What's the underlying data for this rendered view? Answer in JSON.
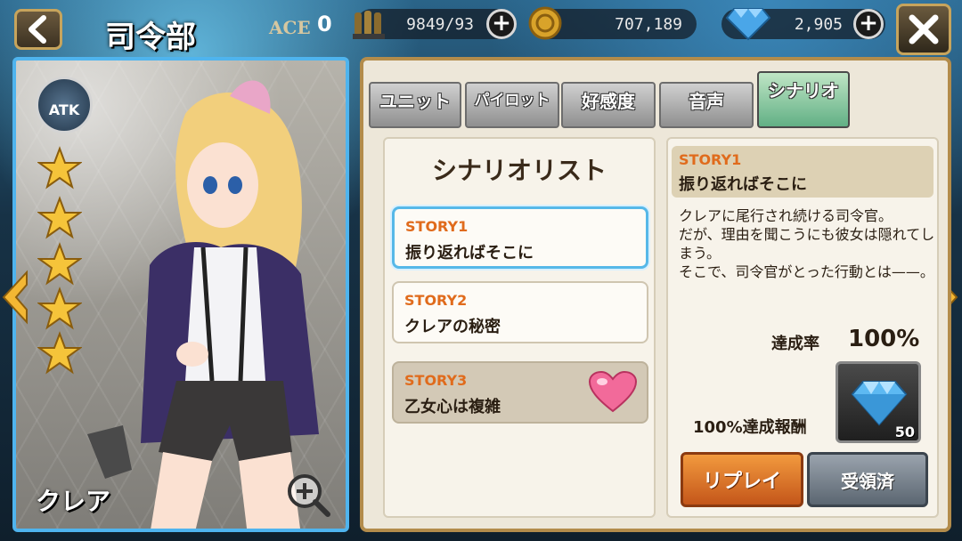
{
  "header": {
    "title": "司令部",
    "ace_label": "ACE",
    "ace_value": "0",
    "ammo": "9849/93",
    "coins": "707,189",
    "gems": "2,905",
    "back_icon": "chevron-left-icon",
    "close_icon": "close-icon"
  },
  "character": {
    "name": "クレア",
    "type_badge": "ATK",
    "stars": 5
  },
  "tabs": [
    {
      "label": "ユニット",
      "active": false
    },
    {
      "label": "パイロット",
      "active": false
    },
    {
      "label": "好感度",
      "active": false
    },
    {
      "label": "音声",
      "active": false
    },
    {
      "label": "シナリオ",
      "active": true
    }
  ],
  "scenario_list": {
    "title": "シナリオリスト",
    "items": [
      {
        "tag": "STORY1",
        "name": "振り返ればそこに",
        "state": "selected"
      },
      {
        "tag": "STORY2",
        "name": "クレアの秘密",
        "state": "normal"
      },
      {
        "tag": "STORY3",
        "name": "乙女心は複雑",
        "state": "locked"
      }
    ]
  },
  "detail": {
    "tag": "STORY1",
    "name": "振り返ればそこに",
    "description": "クレアに尾行され続ける司令官。\nだが、理由を聞こうにも彼女は隠れてしまう。\nそこで、司令官がとった行動とは——。",
    "rate_label": "達成率",
    "rate_value": "100%",
    "reward_label": "100%達成報酬",
    "reward_count": "50",
    "replay_label": "リプレイ",
    "received_label": "受領済"
  },
  "colors": {
    "accent_orange": "#e06b1c",
    "card_border": "#4fb4ee",
    "panel_border": "#b38c4b"
  }
}
